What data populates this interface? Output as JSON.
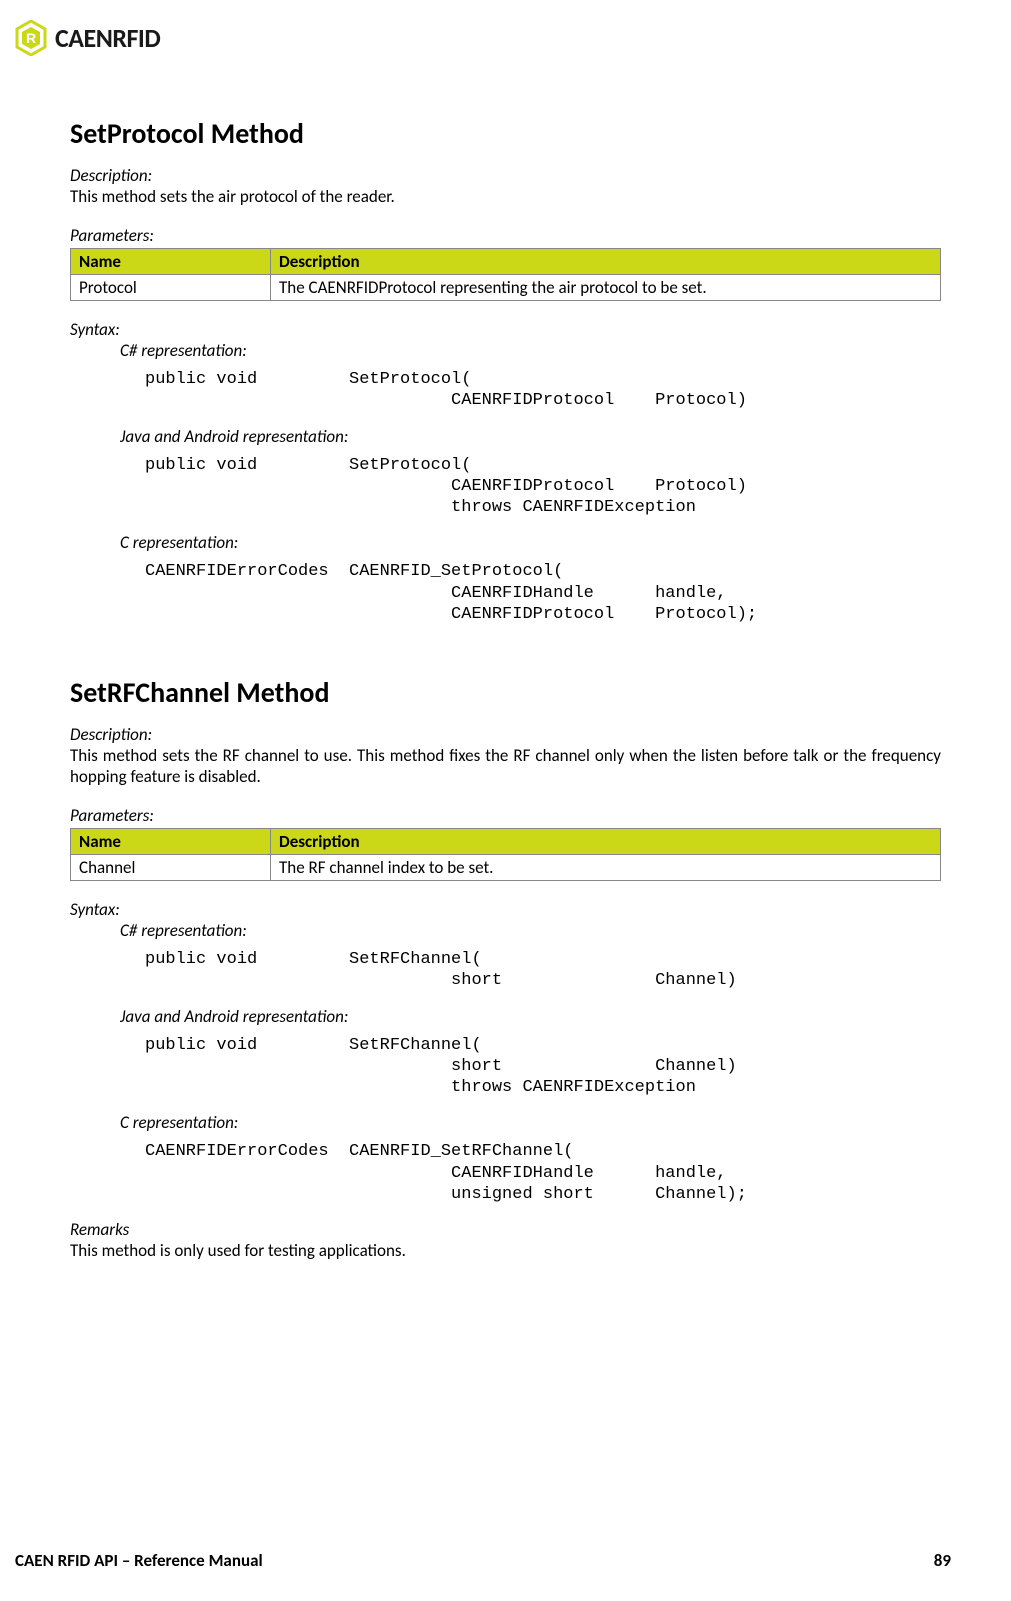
{
  "brand": {
    "name": "CAENRFID"
  },
  "section1": {
    "title": "SetProtocol Method",
    "descLabel": "Description:",
    "descText": "This method sets the air protocol of the reader.",
    "paramsLabel": "Parameters:",
    "paramsTable": {
      "hName": "Name",
      "hDesc": "Description",
      "r0Name": "Protocol",
      "r0Desc": "The CAENRFIDProtocol representing the air protocol to be set."
    },
    "syntaxLabel": "Syntax:",
    "csharp": {
      "label": "C# representation:",
      "code": "public void         SetProtocol(\n                              CAENRFIDProtocol    Protocol)"
    },
    "java": {
      "label": "Java and Android representation:",
      "code": "public void         SetProtocol(\n                              CAENRFIDProtocol    Protocol)\n                              throws CAENRFIDException"
    },
    "c": {
      "label": "C representation:",
      "code": "CAENRFIDErrorCodes  CAENRFID_SetProtocol(\n                              CAENRFIDHandle      handle,\n                              CAENRFIDProtocol    Protocol);"
    }
  },
  "section2": {
    "title": "SetRFChannel Method",
    "descLabel": "Description:",
    "descText": "This method sets the RF channel to use. This method fixes the RF channel only when the listen before talk or the frequency hopping feature is disabled.",
    "paramsLabel": "Parameters:",
    "paramsTable": {
      "hName": "Name",
      "hDesc": "Description",
      "r0Name": "Channel",
      "r0Desc": "The RF channel index to be set."
    },
    "syntaxLabel": "Syntax:",
    "csharp": {
      "label": "C# representation:",
      "code": "public void         SetRFChannel(\n                              short               Channel)"
    },
    "java": {
      "label": "Java and Android representation:",
      "code": "public void         SetRFChannel(\n                              short               Channel)\n                              throws CAENRFIDException"
    },
    "c": {
      "label": "C representation:",
      "code": "CAENRFIDErrorCodes  CAENRFID_SetRFChannel(\n                              CAENRFIDHandle      handle,\n                              unsigned short      Channel);"
    },
    "remarksLabel": "Remarks",
    "remarksText": "This method is only used for testing applications."
  },
  "footer": {
    "left": "CAEN RFID API – Reference Manual",
    "right": "89"
  }
}
